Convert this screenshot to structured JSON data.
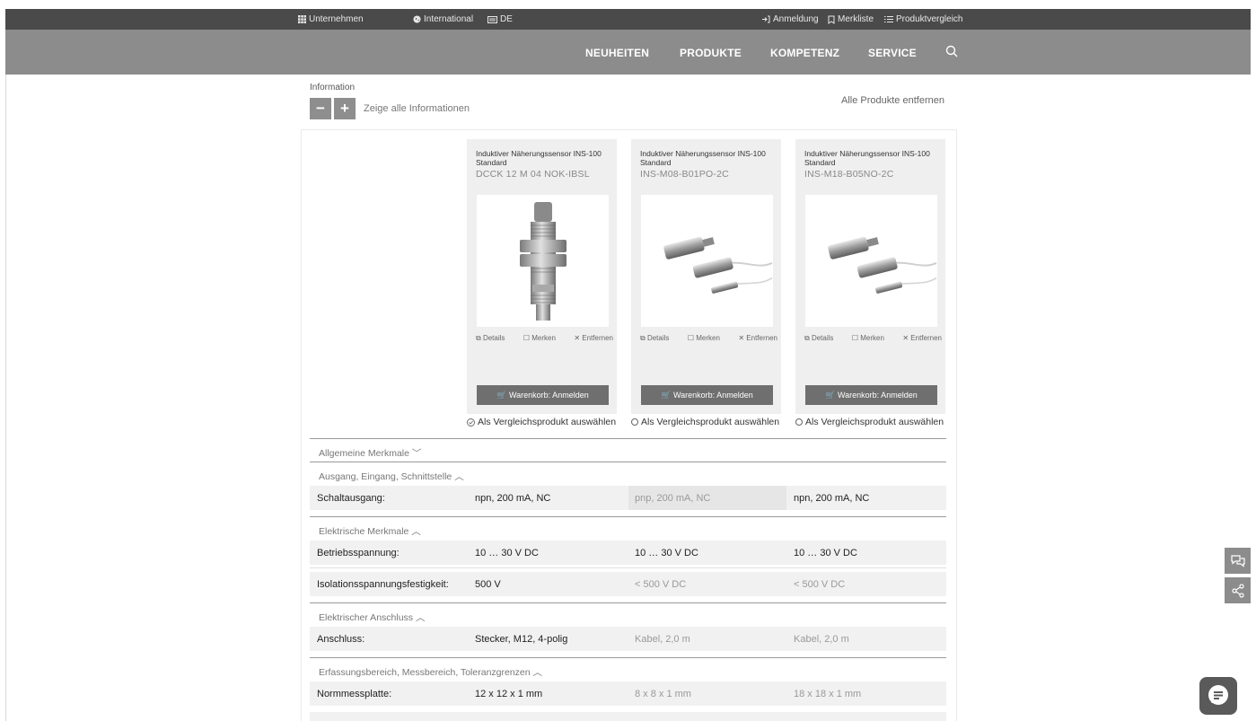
{
  "topbar": {
    "company": "Unternehmen",
    "international": "International",
    "language": "DE",
    "login": "Anmeldung",
    "watchlist": "Merkliste",
    "compare": "Produktvergleich"
  },
  "nav": {
    "items": [
      "NEUHEITEN",
      "PRODUKTE",
      "KOMPETENZ",
      "SERVICE"
    ]
  },
  "info": {
    "label": "Information",
    "minus": "−",
    "plus": "+",
    "show_all": "Zeige alle Informationen",
    "remove_all": "Alle Produkte entfernen"
  },
  "products": [
    {
      "title": "Induktiver Näherungssensor INS-100 Standard",
      "model": "DCCK 12 M 04 NOK-IBSL",
      "details": "Details",
      "remember": "Merken",
      "remove": "Entfernen",
      "cart": "Warenkorb: Anmelden",
      "select": "Als Vergleichsprodukt auswählen",
      "selected": true
    },
    {
      "title": "Induktiver Näherungssensor INS-100 Standard",
      "model": "INS-M08-B01PO-2C",
      "details": "Details",
      "remember": "Merken",
      "remove": "Entfernen",
      "cart": "Warenkorb: Anmelden",
      "select": "Als Vergleichsprodukt auswählen",
      "selected": false
    },
    {
      "title": "Induktiver Näherungssensor INS-100 Standard",
      "model": "INS-M18-B05NO-2C",
      "details": "Details",
      "remember": "Merken",
      "remove": "Entfernen",
      "cart": "Warenkorb: Anmelden",
      "select": "Als Vergleichsprodukt auswählen",
      "selected": false
    }
  ],
  "sections": {
    "general": "Allgemeine Merkmale",
    "output": "Ausgang, Eingang, Schnittstelle",
    "electrical": "Elektrische Merkmale",
    "connection": "Elektrischer Anschluss",
    "range": "Erfassungsbereich, Messbereich, Toleranzgrenzen"
  },
  "rows": {
    "switch_output": {
      "label": "Schaltausgang:",
      "v1": "npn, 200 mA, NC",
      "v2": "pnp, 200 mA, NC",
      "v3": "npn, 200 mA, NC"
    },
    "voltage": {
      "label": "Betriebsspannung:",
      "v1": "10 … 30 V DC",
      "v2": "10 … 30 V DC",
      "v3": "10 … 30 V DC"
    },
    "isolation": {
      "label": "Isolationsspannungsfestigkeit:",
      "v1": "500 V",
      "v2": "< 500 V DC",
      "v3": "< 500 V DC"
    },
    "connection": {
      "label": "Anschluss:",
      "v1": "Stecker, M12, 4-polig",
      "v2": "Kabel, 2,0 m",
      "v3": "Kabel, 2,0 m"
    },
    "plate": {
      "label": "Normmessplatte:",
      "v1": "12 x 12 x 1 mm",
      "v2": "8 x 8 x 1 mm",
      "v3": "18 x 18 x 1 mm"
    }
  },
  "colors": {
    "topbar": "#4a4a4a",
    "nav": "#8c8c8c",
    "card": "#efefef",
    "cart_button": "#6f6f6f"
  }
}
